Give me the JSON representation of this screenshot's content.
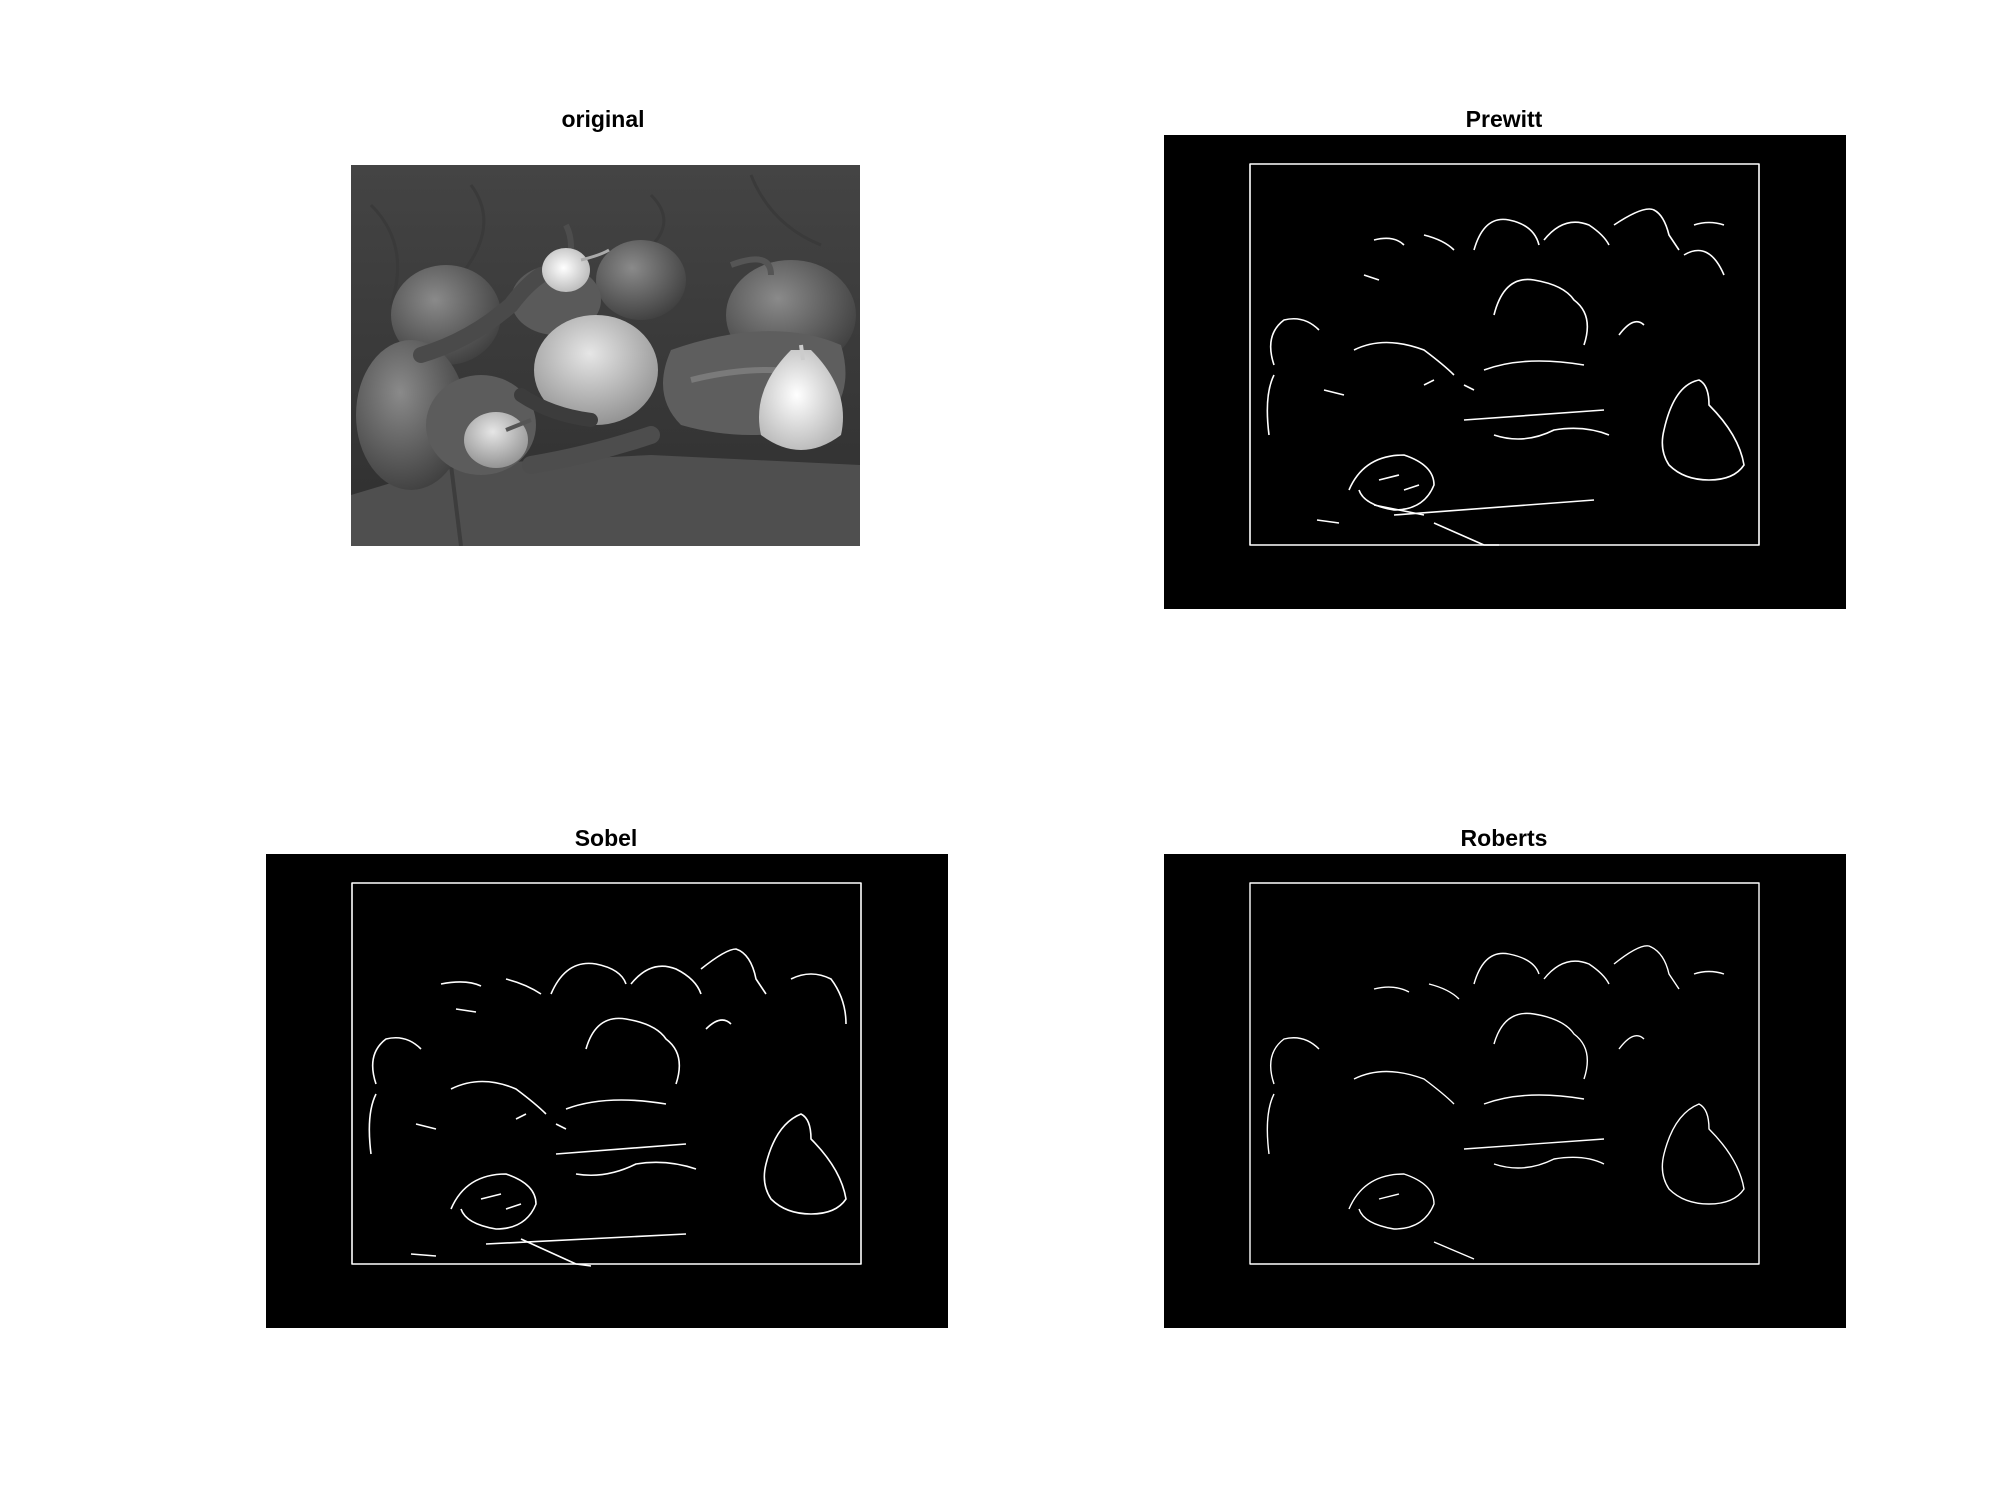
{
  "figure": {
    "background": "#ffffff",
    "panels": [
      {
        "id": "original",
        "title": "original",
        "kind": "grayscale-photo"
      },
      {
        "id": "prewitt",
        "title": "Prewitt",
        "kind": "edge-map"
      },
      {
        "id": "sobel",
        "title": "Sobel",
        "kind": "edge-map"
      },
      {
        "id": "roberts",
        "title": "Roberts",
        "kind": "edge-map"
      }
    ],
    "colors": {
      "edge_background": "#000000",
      "edge_stroke": "#ffffff",
      "photo_backdrop": "#3a3a3a",
      "photo_table": "#555555"
    }
  }
}
